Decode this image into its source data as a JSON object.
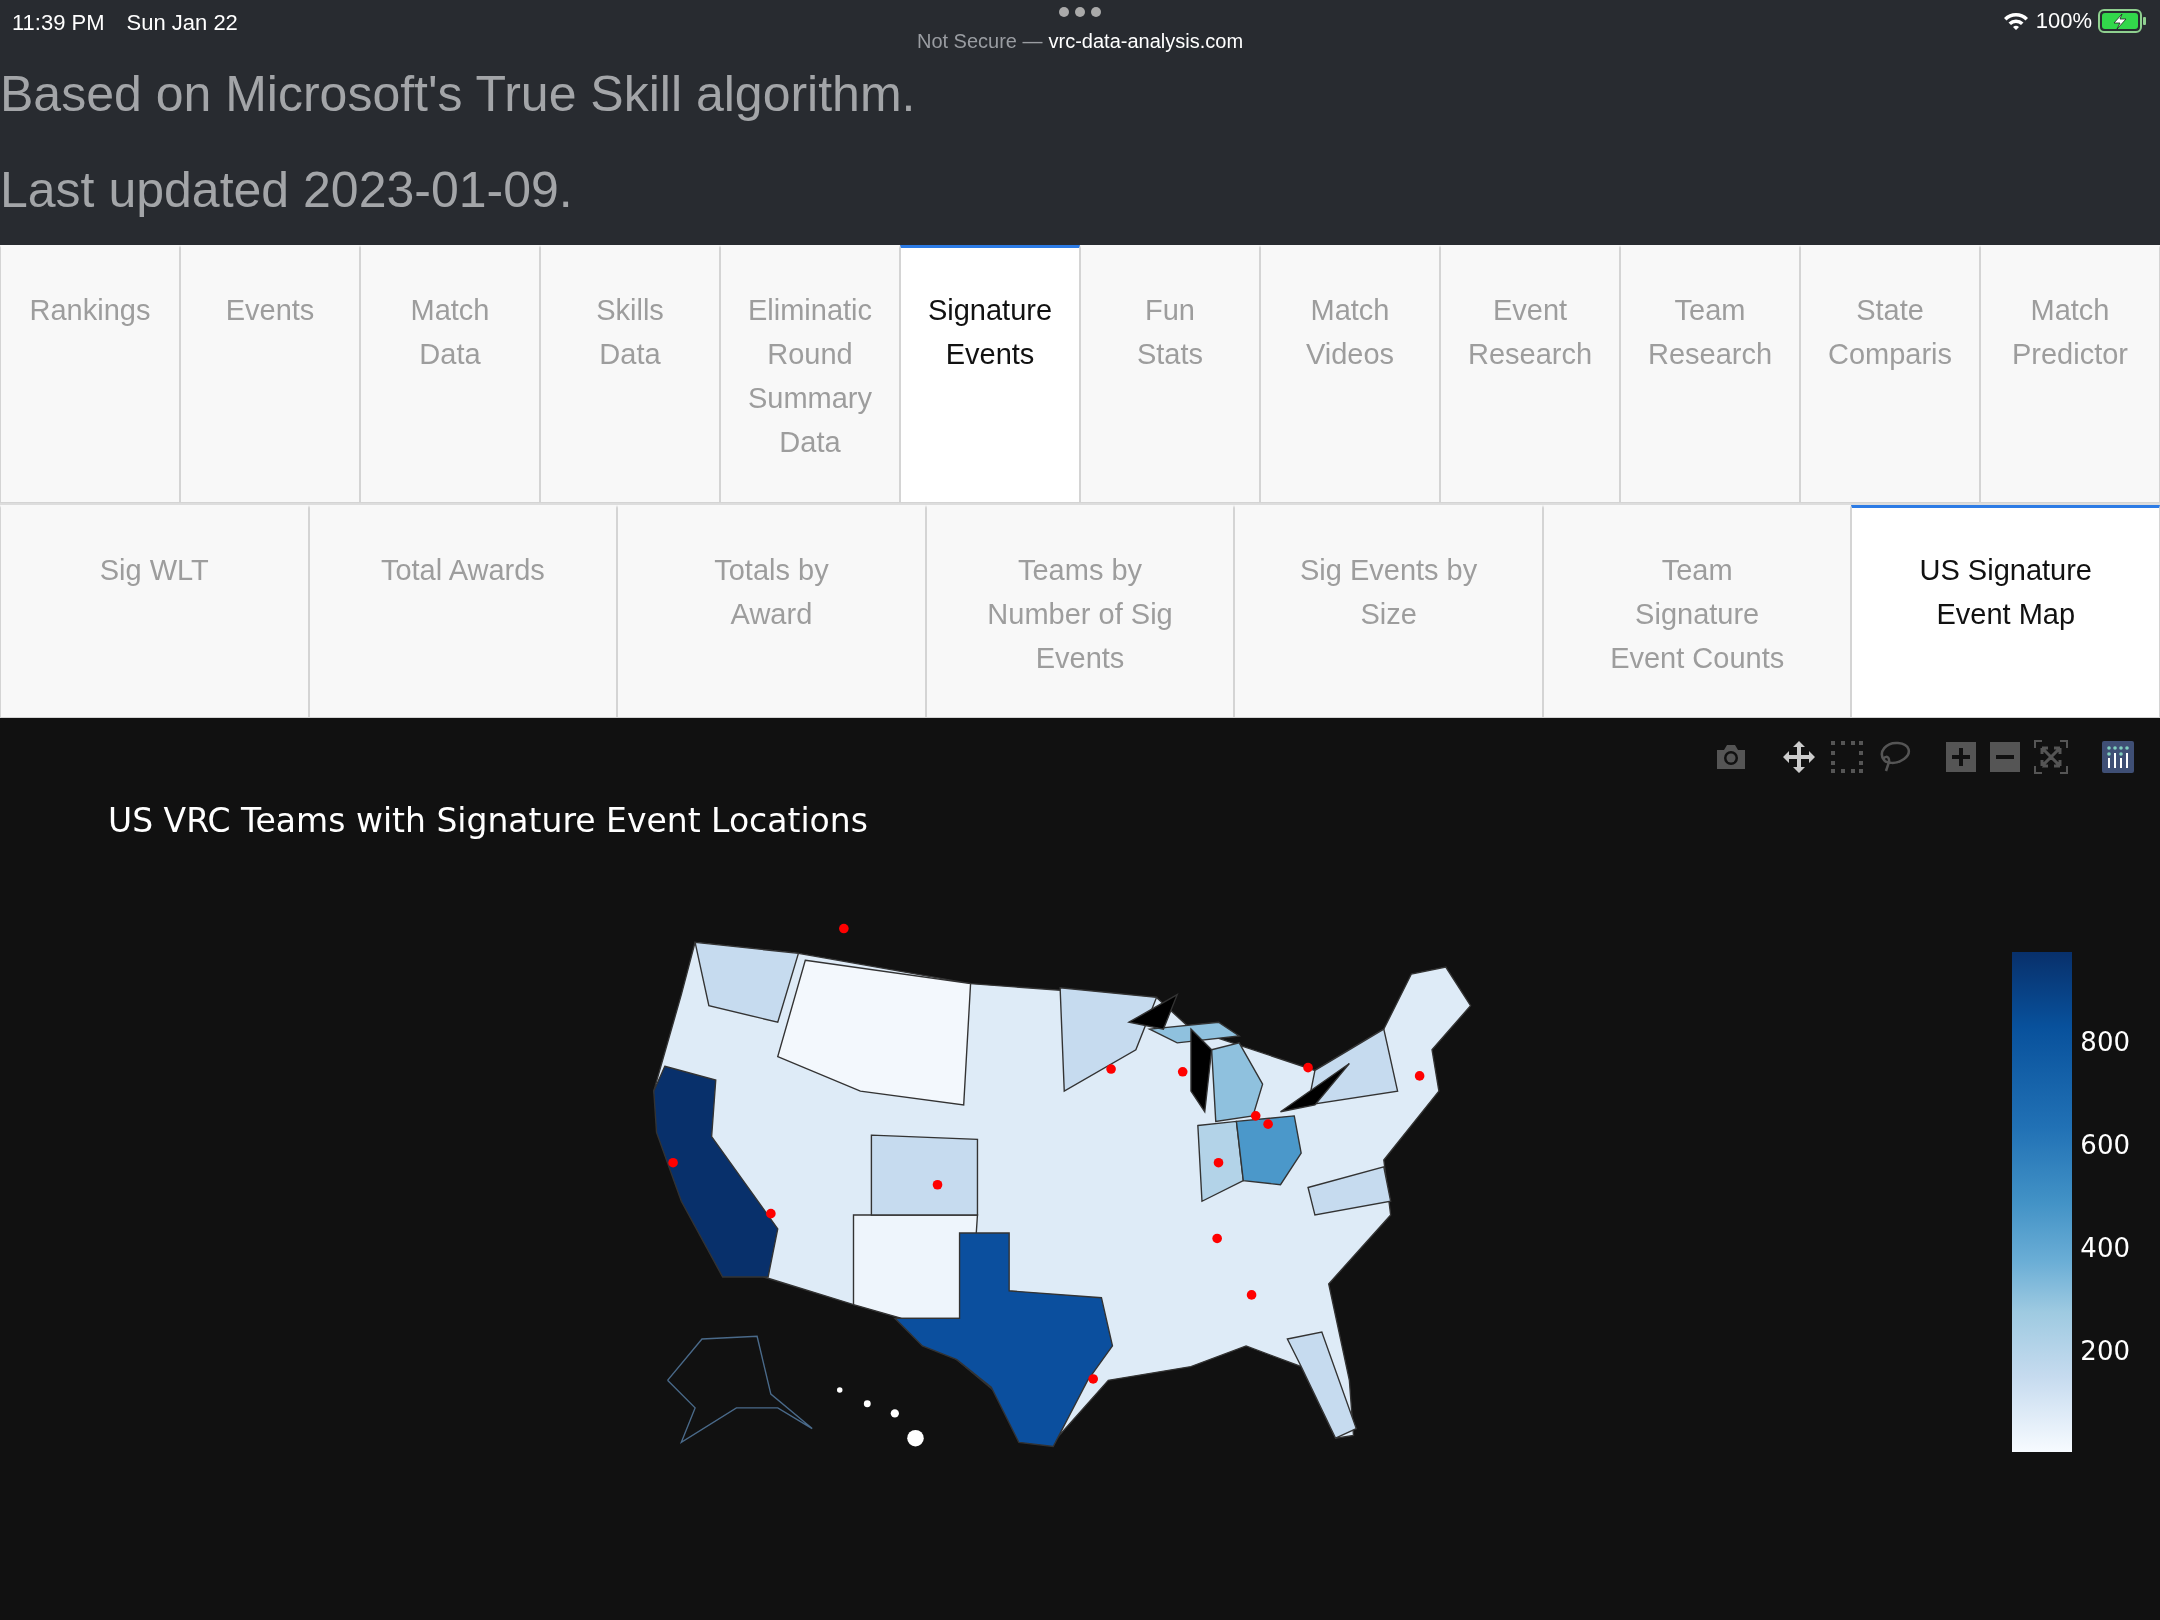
{
  "status_bar": {
    "time": "11:39 PM",
    "date": "Sun Jan 22",
    "security": "Not Secure —",
    "url": "vrc-data-analysis.com",
    "battery": "100%"
  },
  "header": {
    "description": "Based on Microsoft's True Skill algorithm.",
    "last_updated": "Last updated 2023-01-09."
  },
  "tabs": [
    {
      "label": "Rankings",
      "selected": false
    },
    {
      "label": "Events",
      "selected": false
    },
    {
      "label": "Match\nData",
      "selected": false
    },
    {
      "label": "Skills\nData",
      "selected": false
    },
    {
      "label": "Eliminatic\nRound\nSummary\nData",
      "selected": false
    },
    {
      "label": "Signature\nEvents",
      "selected": true
    },
    {
      "label": "Fun\nStats",
      "selected": false
    },
    {
      "label": "Match\nVideos",
      "selected": false
    },
    {
      "label": "Event\nResearch",
      "selected": false
    },
    {
      "label": "Team\nResearch",
      "selected": false
    },
    {
      "label": "State\nComparis",
      "selected": false
    },
    {
      "label": "Match\nPredictor",
      "selected": false
    }
  ],
  "subtabs": [
    {
      "label": "Sig WLT",
      "selected": false
    },
    {
      "label": "Total Awards",
      "selected": false
    },
    {
      "label": "Totals by\nAward",
      "selected": false
    },
    {
      "label": "Teams by\nNumber of Sig\nEvents",
      "selected": false
    },
    {
      "label": "Sig Events by\nSize",
      "selected": false
    },
    {
      "label": "Team\nSignature\nEvent Counts",
      "selected": false
    },
    {
      "label": "US Signature\nEvent Map",
      "selected": true
    }
  ],
  "chart": {
    "title": "US VRC Teams with Signature Event Locations",
    "colorbar_ticks": [
      "800",
      "600",
      "400",
      "200"
    ]
  }
}
